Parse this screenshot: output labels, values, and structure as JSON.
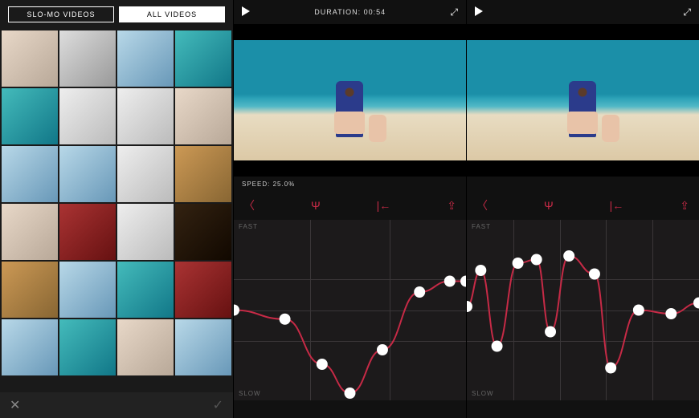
{
  "gallery": {
    "tabs": [
      {
        "label": "SLO-MO VIDEOS",
        "active": false
      },
      {
        "label": "ALL VIDEOS",
        "active": true
      }
    ],
    "thumb_count": 24,
    "close_icon": "✕",
    "confirm_icon": "✓"
  },
  "editor1": {
    "duration_label": "DURATION: 00:54",
    "speed_label": "SPEED: 25.0%",
    "labels": {
      "fast": "FAST",
      "slow": "SLOW"
    },
    "toolbar_icons": [
      "back",
      "tuning-fork",
      "skip-start",
      "share"
    ],
    "curve": {
      "points": [
        {
          "x": 0.0,
          "y": 0.5
        },
        {
          "x": 0.22,
          "y": 0.55
        },
        {
          "x": 0.38,
          "y": 0.8
        },
        {
          "x": 0.5,
          "y": 0.96
        },
        {
          "x": 0.64,
          "y": 0.72
        },
        {
          "x": 0.8,
          "y": 0.4
        },
        {
          "x": 0.93,
          "y": 0.34
        },
        {
          "x": 1.0,
          "y": 0.34
        }
      ]
    }
  },
  "editor2": {
    "labels": {
      "fast": "FAST",
      "slow": "SLOW"
    },
    "toolbar_icons": [
      "back",
      "tuning-fork",
      "skip-start",
      "share"
    ],
    "curve": {
      "points": [
        {
          "x": 0.0,
          "y": 0.48
        },
        {
          "x": 0.06,
          "y": 0.28
        },
        {
          "x": 0.13,
          "y": 0.7
        },
        {
          "x": 0.22,
          "y": 0.24
        },
        {
          "x": 0.3,
          "y": 0.22
        },
        {
          "x": 0.36,
          "y": 0.62
        },
        {
          "x": 0.44,
          "y": 0.2
        },
        {
          "x": 0.55,
          "y": 0.3
        },
        {
          "x": 0.62,
          "y": 0.82
        },
        {
          "x": 0.74,
          "y": 0.5
        },
        {
          "x": 0.88,
          "y": 0.52
        },
        {
          "x": 1.0,
          "y": 0.46
        }
      ]
    }
  },
  "colors": {
    "accent": "#c62a46",
    "bg": "#1c1a1b"
  }
}
